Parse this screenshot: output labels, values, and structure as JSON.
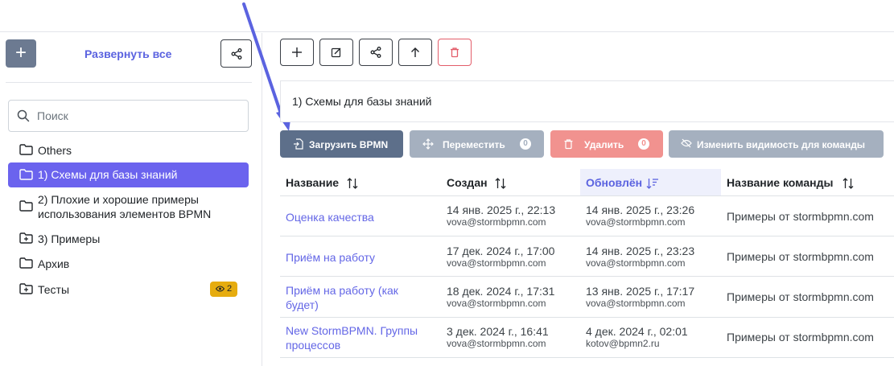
{
  "sidebar": {
    "add_folder_label": "+",
    "expand_all": "Развернуть все",
    "search_placeholder": "Поиск",
    "items": [
      {
        "label": "Others"
      },
      {
        "label": "1) Схемы для базы знаний",
        "active": true
      },
      {
        "label": "2) Плохие и хорошие примеры",
        "label2": "использования элементов BPMN"
      },
      {
        "label": "3) Примеры"
      },
      {
        "label": "Архив"
      },
      {
        "label": "Тесты",
        "badge": "2"
      }
    ]
  },
  "path": "1) Схемы для базы знаний",
  "actions": {
    "upload": "Загрузить BPMN",
    "move": "Переместить",
    "move_count": "0",
    "delete": "Удалить",
    "delete_count": "0",
    "visibility": "Изменить видимость для команды"
  },
  "colors": {
    "accent": "#6b63ee",
    "upload_bg": "#5d6f8a",
    "move_bg": "#a5b0bf",
    "delete_bg": "#f1928f",
    "visibility_bg": "#a5b0bf",
    "badge_yellow": "#e6ac0f",
    "link": "#6366e6"
  },
  "table": {
    "headers": [
      "Название",
      "Создан",
      "Обновлён",
      "Название команды"
    ],
    "sorted_column": "Обновлён",
    "rows": [
      {
        "name": "Оценка качества",
        "name2": "",
        "created": "14 янв. 2025 г., 22:13",
        "created_by": "vova@stormbpmn.com",
        "updated": "14 янв. 2025 г., 23:26",
        "updated_by": "vova@stormbpmn.com",
        "team": "Примеры от stormbpmn.com"
      },
      {
        "name": "Приём на работу",
        "name2": "",
        "created": "17 дек. 2024 г., 17:00",
        "created_by": "vova@stormbpmn.com",
        "updated": "14 янв. 2025 г., 23:23",
        "updated_by": "vova@stormbpmn.com",
        "team": "Примеры от stormbpmn.com"
      },
      {
        "name": "Приём на работу (как",
        "name2": "будет)",
        "created": "18 дек. 2024 г., 17:31",
        "created_by": "vova@stormbpmn.com",
        "updated": "13 янв. 2025 г., 17:17",
        "updated_by": "vova@stormbpmn.com",
        "team": "Примеры от stormbpmn.com"
      },
      {
        "name": "New StormBPMN. Группы",
        "name2": "процессов",
        "created": "3 дек. 2024 г., 16:41",
        "created_by": "vova@stormbpmn.com",
        "updated": "4 дек. 2024 г., 02:01",
        "updated_by": "kotov@bpmn2.ru",
        "team": "Примеры от stormbpmn.com"
      }
    ]
  }
}
